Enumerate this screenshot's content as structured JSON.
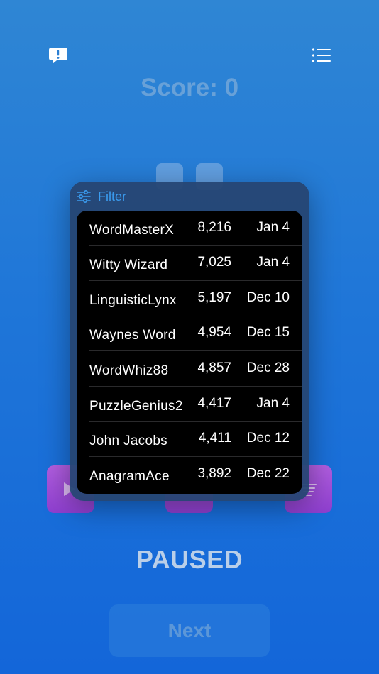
{
  "header": {
    "score_text": "Score: 0"
  },
  "popover": {
    "filter_label": "Filter",
    "rows": [
      {
        "name": "WordMasterX",
        "score": "8,216",
        "date": "Jan 4"
      },
      {
        "name": "Witty Wizard",
        "score": "7,025",
        "date": "Jan 4"
      },
      {
        "name": "LinguisticLynx",
        "score": "5,197",
        "date": "Dec 10"
      },
      {
        "name": "Waynes Word",
        "score": "4,954",
        "date": "Dec 15"
      },
      {
        "name": "WordWhiz88",
        "score": "4,857",
        "date": "Dec 28"
      },
      {
        "name": "PuzzleGenius2",
        "score": "4,417",
        "date": "Jan 4"
      },
      {
        "name": "John Jacobs",
        "score": "4,411",
        "date": "Dec 12"
      },
      {
        "name": "AnagramAce",
        "score": "3,892",
        "date": "Dec 22"
      }
    ]
  },
  "status": {
    "paused_text": "PAUSED"
  },
  "footer": {
    "next_label": "Next"
  },
  "colors": {
    "accent": "#3a9cf0",
    "purple": "#9b4bd6",
    "background": "#1f76d8"
  }
}
